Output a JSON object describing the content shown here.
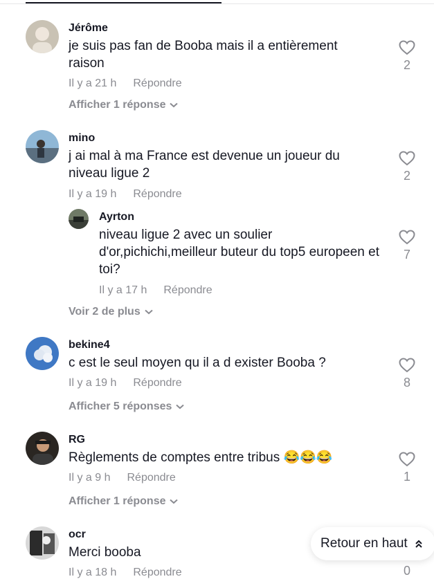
{
  "comments": [
    {
      "username": "Jérôme",
      "text": "je suis pas fan de Booba mais il a entièrement raison",
      "time": "Il y a 21 h",
      "reply_label": "Répondre",
      "likes": "2",
      "toggle": "Afficher 1 réponse"
    },
    {
      "username": "mino",
      "text": "j ai mal à ma France est devenue un joueur du niveau ligue 2",
      "time": "Il y a 19 h",
      "reply_label": "Répondre",
      "likes": "2",
      "reply": {
        "username": "Ayrton",
        "text": "niveau ligue 2 avec un soulier d'or,pichichi,meilleur buteur du top5 europeen et toi?",
        "time": "Il y a 17 h",
        "reply_label": "Répondre",
        "likes": "7"
      },
      "toggle": "Voir 2 de plus"
    },
    {
      "username": "bekine4",
      "text": "c est le seul moyen qu il a d exister Booba ?",
      "time": "Il y a 19 h",
      "reply_label": "Répondre",
      "likes": "8",
      "toggle": "Afficher 5 réponses"
    },
    {
      "username": "RG",
      "text": "Règlements de comptes entre tribus 😂😂😂",
      "time": "Il y a 9 h",
      "reply_label": "Répondre",
      "likes": "1",
      "toggle": "Afficher 1 réponse"
    },
    {
      "username": "ocr",
      "text": "Merci booba",
      "time": "Il y a 18 h",
      "reply_label": "Répondre",
      "likes": "0"
    }
  ],
  "back_to_top": "Retour en haut",
  "icons": {
    "like": "heart-outline-icon",
    "expand": "chevron-down-icon",
    "back_to_top": "chevrons-up-icon"
  },
  "colors": {
    "text": "#161823",
    "muted": "#8a8b91"
  }
}
